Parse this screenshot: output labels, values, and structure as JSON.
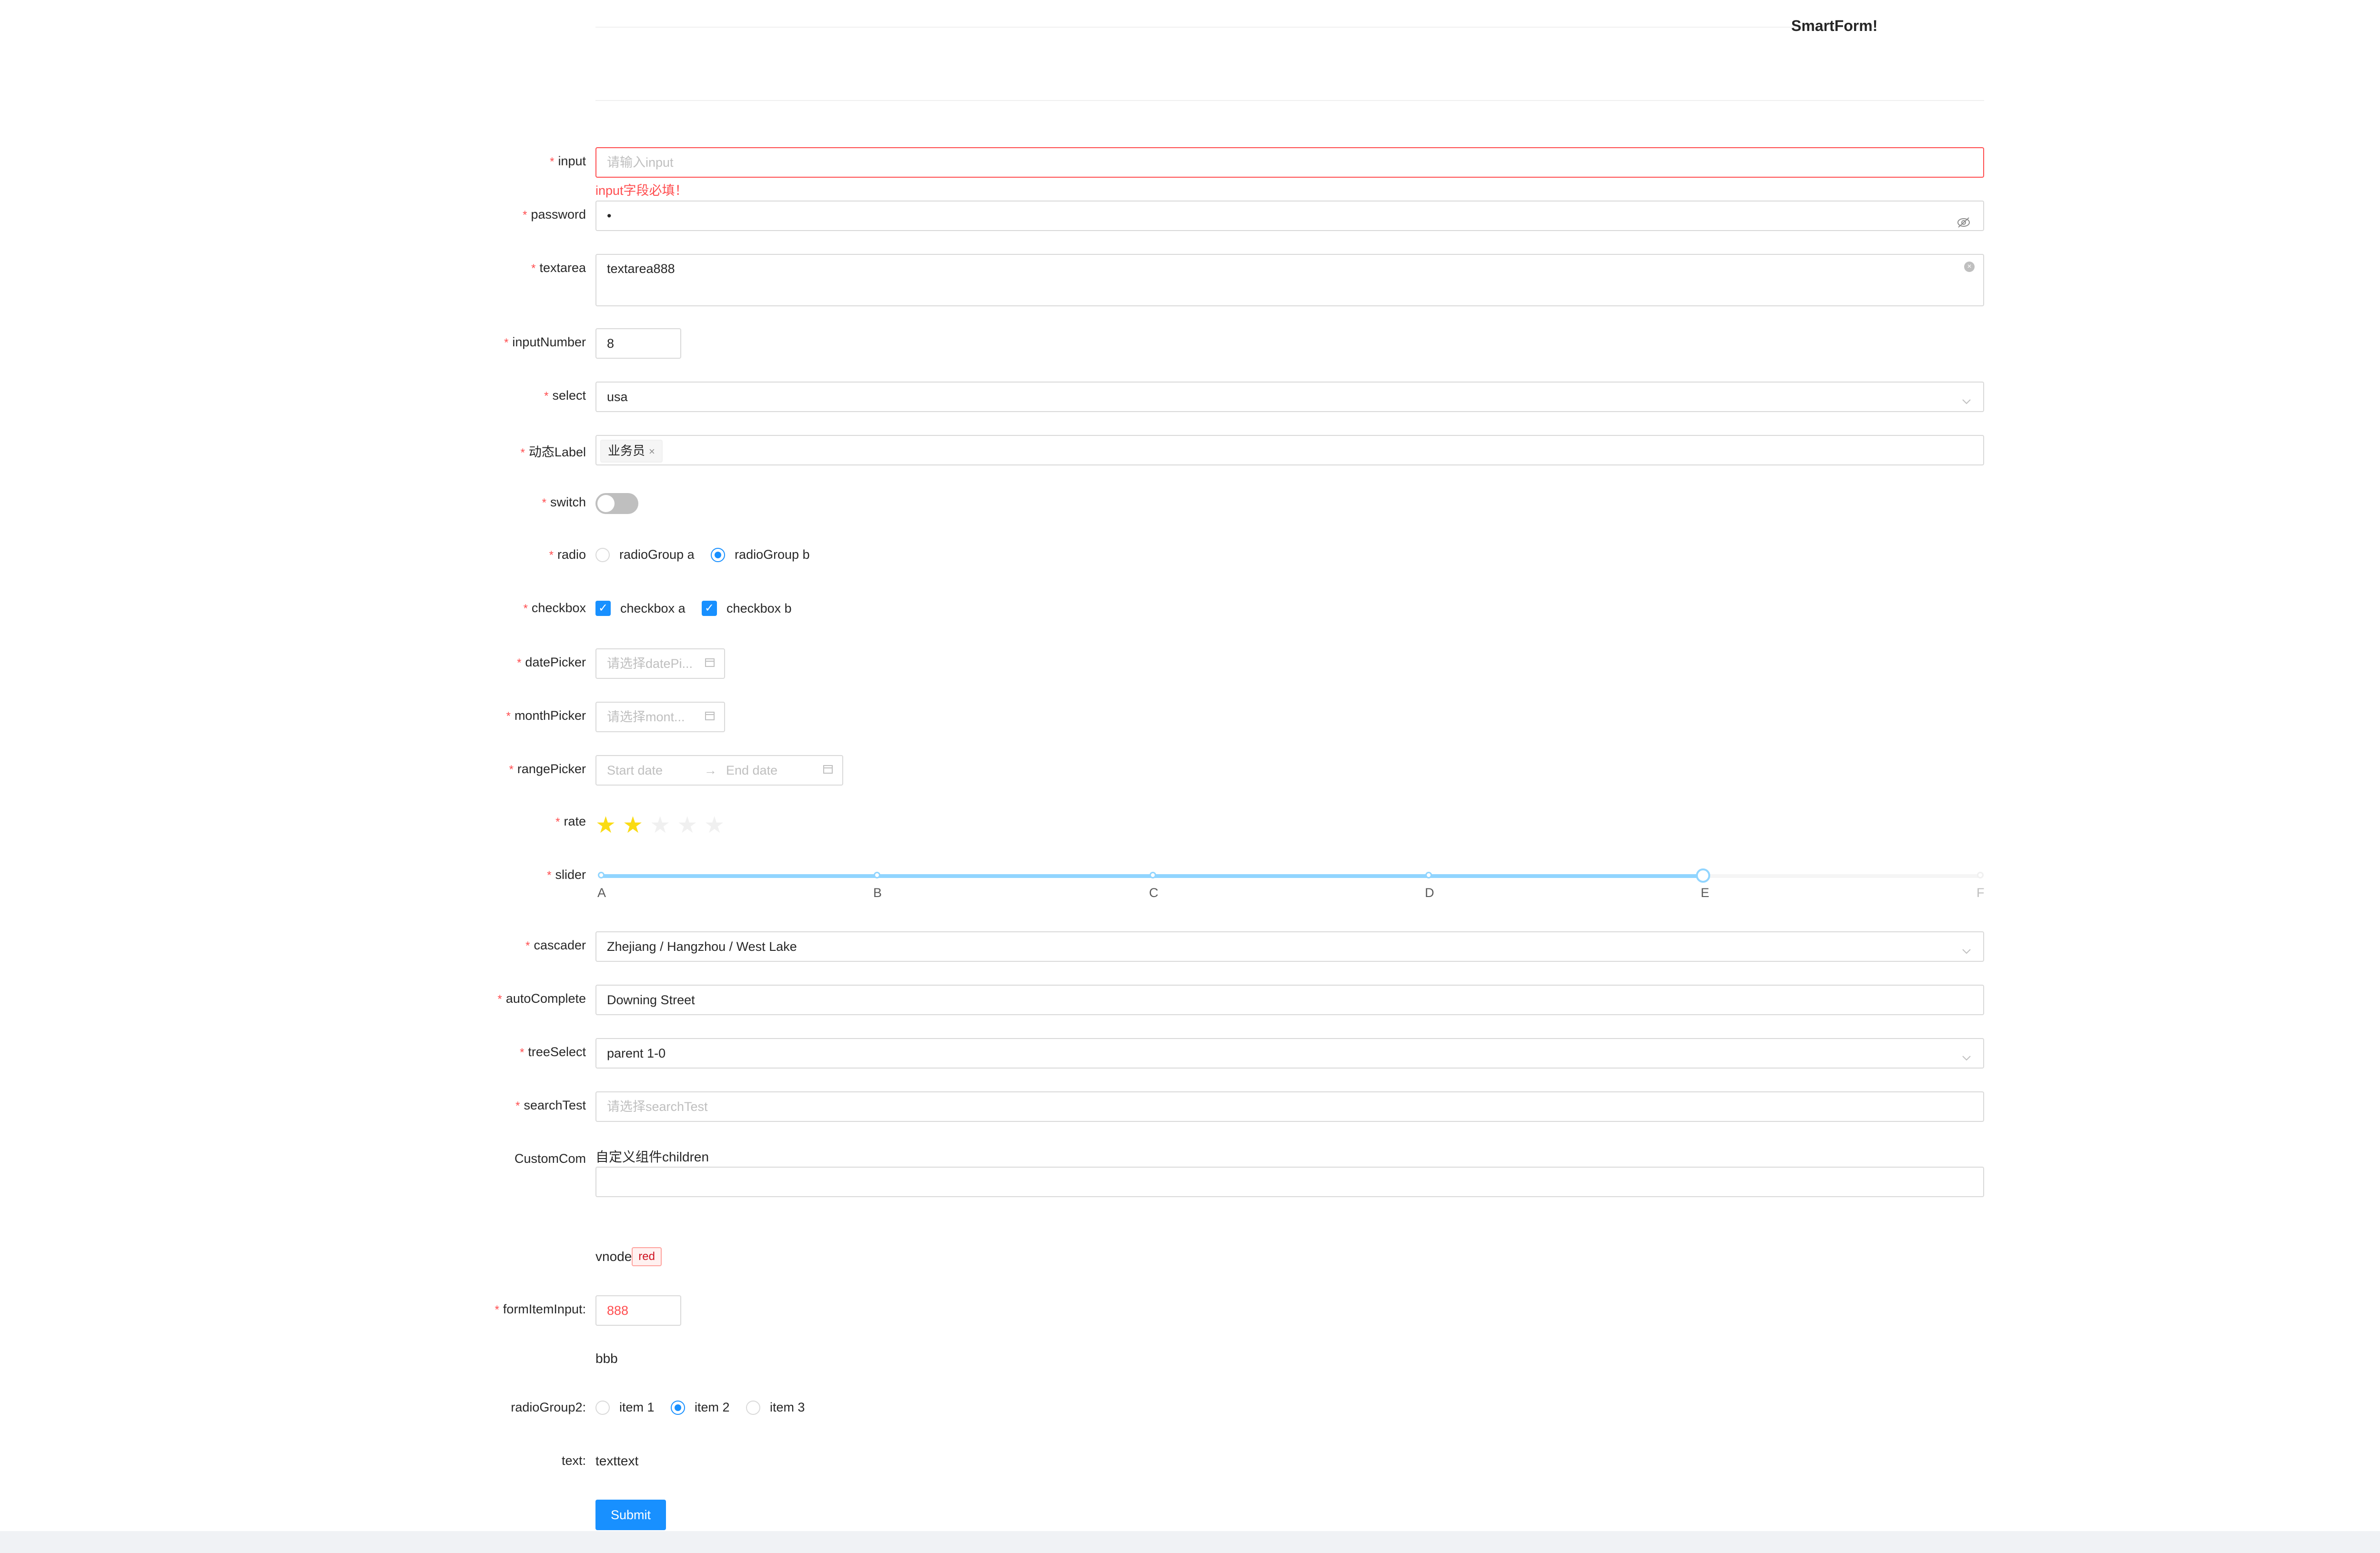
{
  "title": "SmartForm!",
  "fields": {
    "input": {
      "label": "input",
      "placeholder": "请输入input",
      "error": "input字段必填！"
    },
    "password": {
      "label": "password",
      "value": "•"
    },
    "textarea": {
      "label": "textarea",
      "value": "textarea888"
    },
    "inputNumber": {
      "label": "inputNumber",
      "value": "8"
    },
    "select": {
      "label": "select",
      "value": "usa"
    },
    "dynamicLabel": {
      "label": "动态Label",
      "tag": "业务员",
      "tag_close": "×"
    },
    "switch": {
      "label": "switch",
      "checked": false
    },
    "radio": {
      "label": "radio",
      "options": [
        "radioGroup a",
        "radioGroup b"
      ],
      "selected": "radioGroup b"
    },
    "checkbox": {
      "label": "checkbox",
      "options": [
        "checkbox a",
        "checkbox b"
      ],
      "checked": [
        "checkbox a",
        "checkbox b"
      ]
    },
    "datePicker": {
      "label": "datePicker",
      "placeholder": "请选择datePi..."
    },
    "monthPicker": {
      "label": "monthPicker",
      "placeholder": "请选择mont..."
    },
    "rangePicker": {
      "label": "rangePicker",
      "start_placeholder": "Start date",
      "separator": "→",
      "end_placeholder": "End date"
    },
    "rate": {
      "label": "rate",
      "value": 2,
      "max": 5
    },
    "slider": {
      "label": "slider",
      "marks": [
        "A",
        "B",
        "C",
        "D",
        "E",
        "F"
      ],
      "value": "E"
    },
    "cascader": {
      "label": "cascader",
      "value": "Zhejiang / Hangzhou / West Lake"
    },
    "autoComplete": {
      "label": "autoComplete",
      "value": "Downing Street"
    },
    "treeSelect": {
      "label": "treeSelect",
      "value": "parent 1-0"
    },
    "searchTest": {
      "label": "searchTest",
      "placeholder": "请选择searchTest"
    },
    "customCom": {
      "label": "CustomCom",
      "title": "自定义组件children",
      "value": ""
    },
    "vnode": {
      "text": "vnode",
      "tag": "red"
    },
    "formItemInput": {
      "label": "formItemInput",
      "value": "888"
    },
    "bbb": {
      "text": "bbb"
    },
    "radioGroup2": {
      "label": "radioGroup2",
      "options": [
        "item 1",
        "item 2",
        "item 3"
      ],
      "selected": "item 2"
    },
    "text": {
      "label": "text",
      "value": "texttext"
    }
  },
  "submit_label": "Submit",
  "colon": ":",
  "required_mark": "*",
  "icons": {
    "eye": "eye-invisible-icon",
    "clear": "close-circle-icon",
    "chevron": "chevron-down-icon",
    "calendar": "calendar-icon",
    "star": "star-icon",
    "check": "check-icon"
  },
  "colors": {
    "primary": "#1890ff",
    "error": "#ff4d4f",
    "star": "#fadb14"
  }
}
